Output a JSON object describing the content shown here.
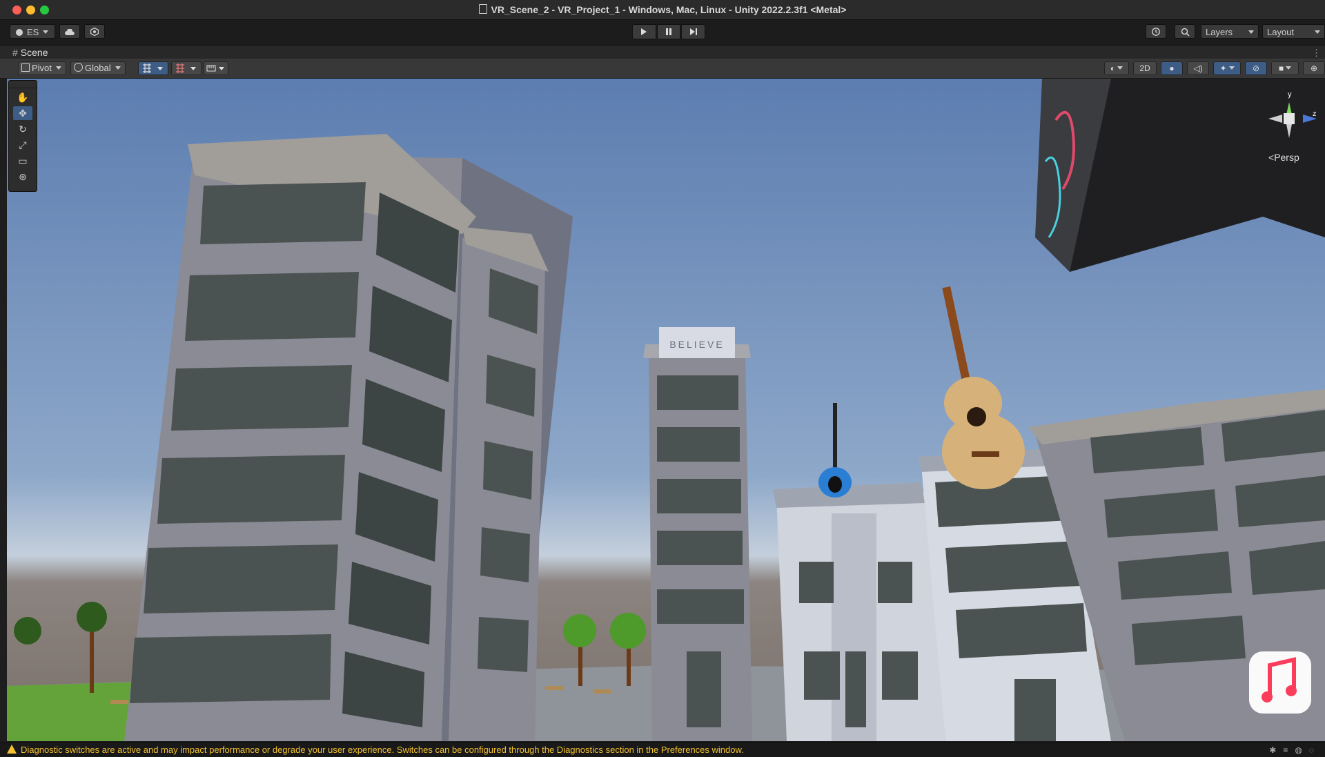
{
  "window": {
    "title": "VR_Scene_2 - VR_Project_1 - Windows, Mac, Linux - Unity 2022.2.3f1 <Metal>"
  },
  "toolbar": {
    "account_label": "ES",
    "play_icon": "play-icon",
    "pause_icon": "pause-icon",
    "step_icon": "step-icon",
    "layers_label": "Layers",
    "layout_label": "Layout"
  },
  "scene_tab": {
    "label": "Scene"
  },
  "scene_toolbar": {
    "pivot_label": "Pivot",
    "global_label": "Global",
    "mode_2d_label": "2D"
  },
  "tools": [
    "hand-icon",
    "move-icon",
    "rotate-icon",
    "scale-icon",
    "rect-icon",
    "transform-icon"
  ],
  "gizmo": {
    "y_label": "y",
    "z_label": "z",
    "projection_label": "Persp"
  },
  "scene": {
    "sign_text": "BELIEVE"
  },
  "status": {
    "message": "Diagnostic switches are active and may impact performance or degrade your user experience. Switches can be configured through the Diagnostics section in the Preferences window."
  },
  "colors": {
    "accent": "#3d5d86",
    "warning": "#f4c230",
    "sky_top": "#5c7db0",
    "sky_bottom": "#c4cfdc"
  }
}
